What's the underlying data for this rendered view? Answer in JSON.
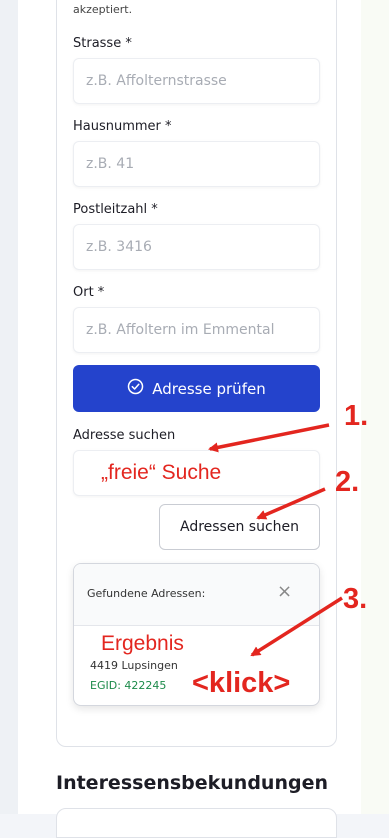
{
  "form": {
    "note": "akzeptiert.",
    "street": {
      "label": "Strasse *",
      "placeholder": "z.B. Affolternstrasse"
    },
    "house_number": {
      "label": "Hausnummer *",
      "placeholder": "z.B. 41"
    },
    "postal_code": {
      "label": "Postleitzahl *",
      "placeholder": "z.B. 3416"
    },
    "city": {
      "label": "Ort *",
      "placeholder": "z.B. Affoltern im Emmental"
    },
    "check_button": "Adresse prüfen",
    "search_label": "Adresse suchen",
    "search_value": "",
    "search_button": "Adressen suchen",
    "results": {
      "title": "Gefundene Adressen:",
      "close": "×",
      "items": [
        {
          "address": "4419 Lupsingen",
          "egid": "EGID: 422245"
        }
      ]
    }
  },
  "next_section": {
    "title": "Interessensbekundungen"
  },
  "annotations": {
    "step1": "1.",
    "step1_text": "„freie“ Suche",
    "step2": "2.",
    "step3": "3.",
    "result_text": "Ergebnis",
    "click_text": "<klick>"
  },
  "colors": {
    "primary": "#2443cc",
    "annotation": "#e3261f",
    "egid": "#1c8a4a"
  }
}
